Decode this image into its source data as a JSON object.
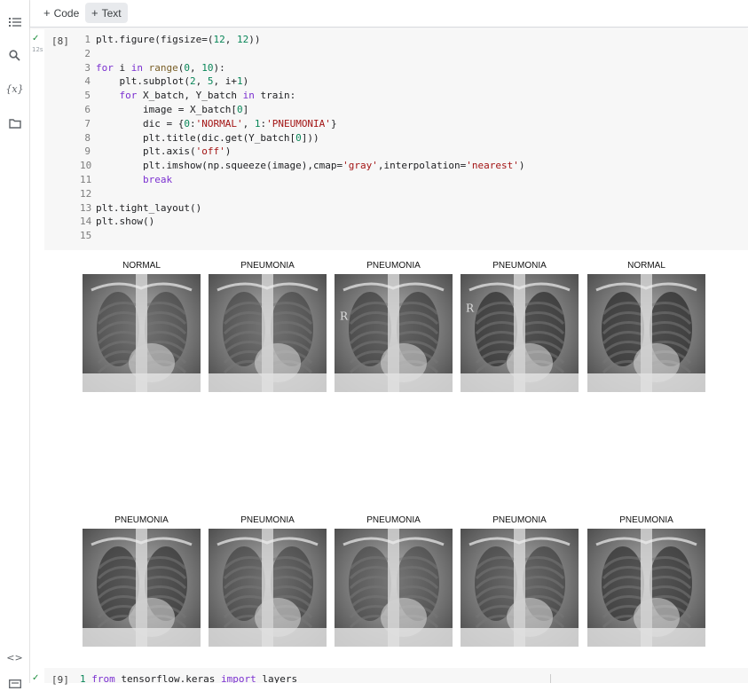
{
  "toolbar": {
    "code_label": "Code",
    "text_label": "Text"
  },
  "sidebar": {
    "icons": [
      "table-of-contents-icon",
      "search-icon",
      "variables-icon",
      "files-icon",
      "code-snippets-icon",
      "terminal-icon"
    ]
  },
  "cell": {
    "exec_count": "[8]",
    "exec_time": "12s",
    "lines": [
      {
        "n": "1",
        "html": "<span class=\"tx\">plt.figure(figsize=(</span><span class=\"num\">12</span><span class=\"tx\">, </span><span class=\"num\">12</span><span class=\"tx\">))</span>"
      },
      {
        "n": "2",
        "html": ""
      },
      {
        "n": "3",
        "html": "<span class=\"kw\">for</span><span class=\"tx\"> i </span><span class=\"kw\">in</span><span class=\"tx\"> </span><span class=\"fn\">range</span><span class=\"tx\">(</span><span class=\"num\">0</span><span class=\"tx\">, </span><span class=\"num\">10</span><span class=\"tx\">):</span>"
      },
      {
        "n": "4",
        "html": "<span class=\"tx\">    plt.subplot(</span><span class=\"num\">2</span><span class=\"tx\">, </span><span class=\"num\">5</span><span class=\"tx\">, i+</span><span class=\"num\">1</span><span class=\"tx\">)</span>"
      },
      {
        "n": "5",
        "html": "<span class=\"tx\">    </span><span class=\"kw\">for</span><span class=\"tx\"> X_batch, Y_batch </span><span class=\"kw\">in</span><span class=\"tx\"> train:</span>"
      },
      {
        "n": "6",
        "html": "<span class=\"tx\">        image = X_batch[</span><span class=\"num\">0</span><span class=\"tx\">]</span>"
      },
      {
        "n": "7",
        "html": "<span class=\"tx\">        dic = {</span><span class=\"num\">0</span><span class=\"tx\">:</span><span class=\"str\">'NORMAL'</span><span class=\"tx\">, </span><span class=\"num\">1</span><span class=\"tx\">:</span><span class=\"str\">'PNEUMONIA'</span><span class=\"tx\">}</span>"
      },
      {
        "n": "8",
        "html": "<span class=\"tx\">        plt.title(dic.get(Y_batch[</span><span class=\"num\">0</span><span class=\"tx\">]))</span>"
      },
      {
        "n": "9",
        "html": "<span class=\"tx\">        plt.axis(</span><span class=\"str\">'off'</span><span class=\"tx\">)</span>"
      },
      {
        "n": "10",
        "html": "<span class=\"tx\">        plt.imshow(np.squeeze(image),cmap=</span><span class=\"str\">'gray'</span><span class=\"tx\">,interpolation=</span><span class=\"str\">'nearest'</span><span class=\"tx\">)</span>"
      },
      {
        "n": "11",
        "html": "<span class=\"tx\">        </span><span class=\"kw\">break</span>"
      },
      {
        "n": "12",
        "html": ""
      },
      {
        "n": "13",
        "html": "<span class=\"tx\">plt.tight_layout()</span>"
      },
      {
        "n": "14",
        "html": "<span class=\"tx\">plt.show()</span>"
      },
      {
        "n": "15",
        "html": ""
      }
    ]
  },
  "output": {
    "titles": [
      "NORMAL",
      "PNEUMONIA",
      "PNEUMONIA",
      "PNEUMONIA",
      "NORMAL",
      "PNEUMONIA",
      "PNEUMONIA",
      "PNEUMONIA",
      "PNEUMONIA",
      "PNEUMONIA"
    ],
    "image_markers": [
      "",
      "",
      "R",
      "R",
      "",
      "",
      "",
      "",
      "",
      ""
    ]
  },
  "next_cell": {
    "exec_count": "[9]",
    "code_html": "<span class=\"num\">1</span><span class=\"tx\"> </span><span class=\"kw\">from</span><span class=\"tx\"> tensorflow.keras </span><span class=\"kw\">import</span><span class=\"tx\"> layers</span>"
  }
}
